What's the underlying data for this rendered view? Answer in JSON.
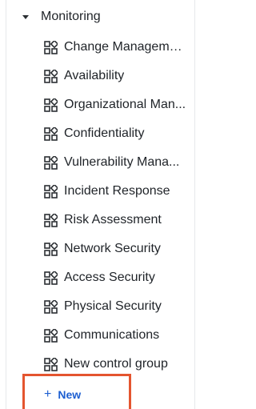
{
  "section": {
    "title": "Monitoring",
    "expanded": true,
    "caret_icon": "caret-down-icon"
  },
  "item_icon": "control-group-icon",
  "items": [
    {
      "label": "Change Manageme..."
    },
    {
      "label": "Availability"
    },
    {
      "label": "Organizational Man..."
    },
    {
      "label": "Confidentiality"
    },
    {
      "label": "Vulnerability Mana..."
    },
    {
      "label": "Incident Response"
    },
    {
      "label": "Risk Assessment"
    },
    {
      "label": "Network Security"
    },
    {
      "label": "Access Security"
    },
    {
      "label": "Physical Security"
    },
    {
      "label": "Communications"
    },
    {
      "label": "New control group"
    }
  ],
  "new_button": {
    "icon": "plus-icon",
    "plus": "+",
    "label": "New",
    "highlight_color": "#e4552f"
  },
  "colors": {
    "text": "#1f2328",
    "accent": "#1d5fd1",
    "divider": "#e6e8eb"
  }
}
